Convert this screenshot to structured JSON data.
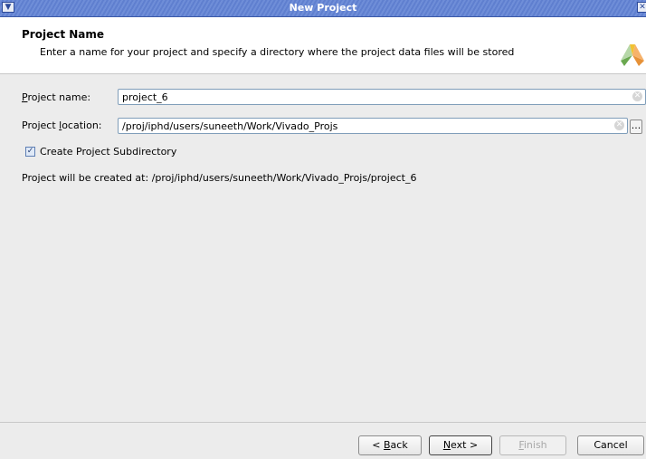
{
  "window": {
    "title": "New Project"
  },
  "header": {
    "title": "Project Name",
    "description": "Enter a name for your project and specify a directory where the project data files will be stored"
  },
  "form": {
    "project_name_label_pre": "",
    "project_name_label_mn": "P",
    "project_name_label_post": "roject name:",
    "project_name_value": "project_6",
    "project_location_label_pre": "Project ",
    "project_location_label_mn": "l",
    "project_location_label_post": "ocation:",
    "project_location_value": "/proj/iphd/users/suneeth/Work/Vivado_Projs",
    "browse_label": "...",
    "create_subdir_label": "Create Project Subdirectory",
    "create_subdir_checked": true,
    "created_at_text": "Project will be created at: /proj/iphd/users/suneeth/Work/Vivado_Projs/project_6"
  },
  "buttons": {
    "back_pre": "< ",
    "back_mn": "B",
    "back_post": "ack",
    "next_pre": "",
    "next_mn": "N",
    "next_post": "ext >",
    "finish_pre": "",
    "finish_mn": "F",
    "finish_post": "inish",
    "cancel": "Cancel"
  },
  "icons": {
    "system_menu": "chevron-down-icon",
    "close": "close-icon",
    "logo": "vivado-logo-icon",
    "clear": "clear-icon"
  }
}
